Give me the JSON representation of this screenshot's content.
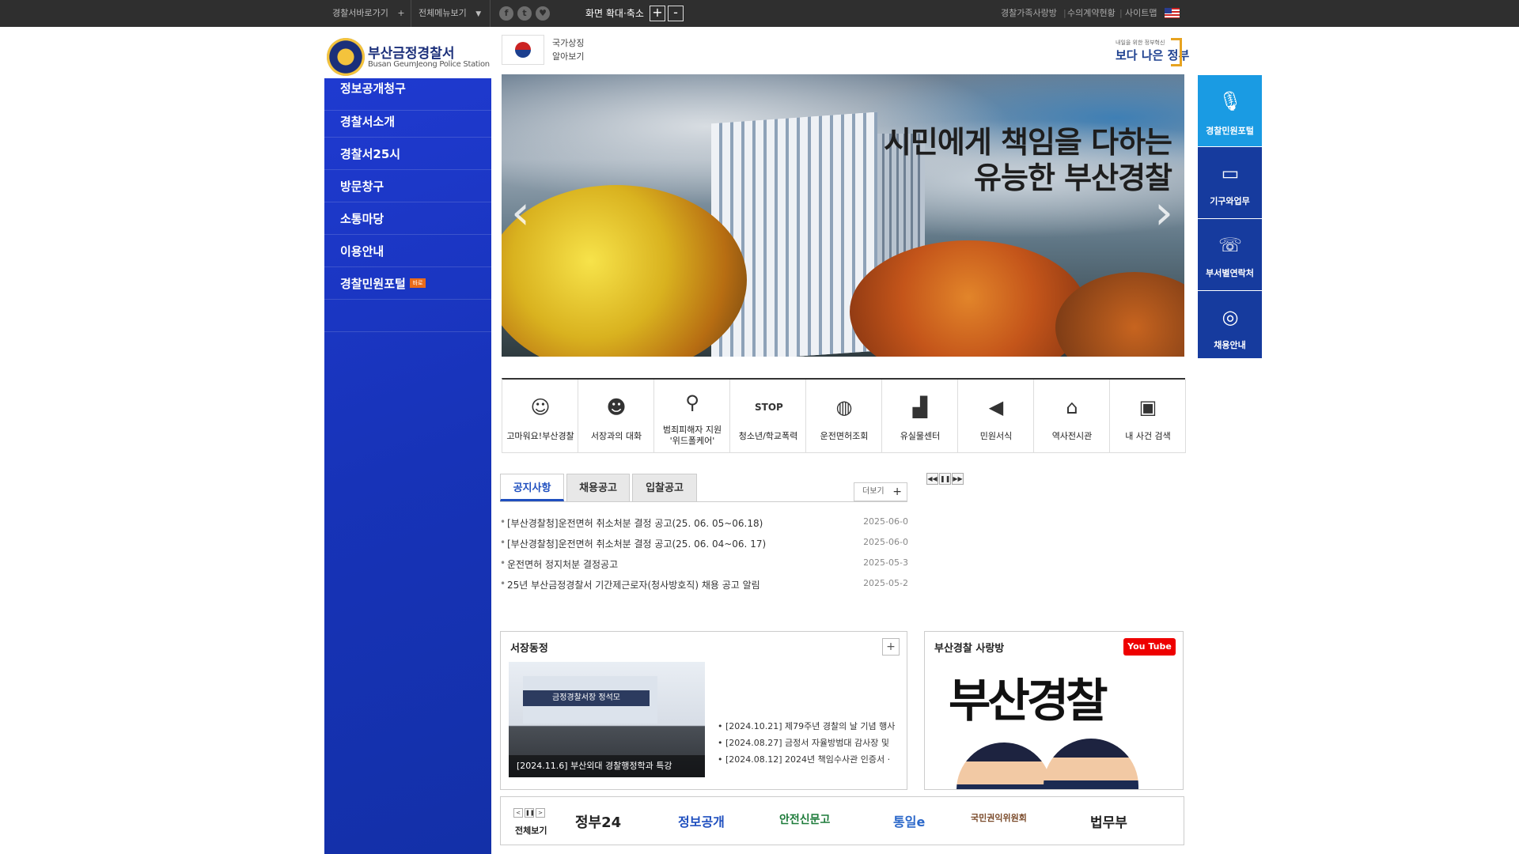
{
  "topbar": {
    "shortcut": "경찰서바로가기",
    "shortcut_glyph": "+",
    "all_menu": "전체메뉴보기",
    "all_menu_glyph": "▼",
    "sns": [
      "f",
      "t",
      "♥"
    ],
    "zoom_label": "화면 확대·축소",
    "zoom_in": "+",
    "zoom_out": "-",
    "links": [
      "경찰가족사랑방",
      "수의계약현황",
      "사이트맵"
    ]
  },
  "header": {
    "logo_ko": "부산금정경찰서",
    "logo_en": "Busan GeumJeong Police Station",
    "national_symbol_line1": "국가상징",
    "national_symbol_line2": "알아보기",
    "gov_small": "내일을 위한 정부혁신",
    "gov_big": "보다 나은 정부"
  },
  "leftnav": {
    "items": [
      "정보공개청구",
      "경찰서소개",
      "경찰서25시",
      "방문창구",
      "소통마당",
      "이용안내",
      "경찰민원포털"
    ],
    "badge": "바로"
  },
  "slider": {
    "line1": "시민에게 책임을 다하는",
    "line2": "유능한 부산경찰",
    "prev": "‹",
    "next": "›"
  },
  "quick": [
    {
      "label": "경찰민원포털",
      "icon": "microphone-icon",
      "glyph": "🎙",
      "color": "#1a9be3"
    },
    {
      "label": "기구와업무",
      "icon": "monitor-icon",
      "glyph": "▭",
      "color": "#163b9e"
    },
    {
      "label": "부서별연락처",
      "icon": "phone-icon",
      "glyph": "☏",
      "color": "#163b9e"
    },
    {
      "label": "채용안내",
      "icon": "lightbulb-icon",
      "glyph": "◎",
      "color": "#163b9e"
    }
  ],
  "services": [
    {
      "label": "고마워요!부산경찰",
      "icon": "police-mascot-icon",
      "glyph": "☺"
    },
    {
      "label": "서장과의 대화",
      "icon": "chat-bubble-icon",
      "glyph": "☻"
    },
    {
      "label": "범죄피해자 지원\n'위드폴케어'",
      "icon": "search-magnifier-icon",
      "glyph": "⚲"
    },
    {
      "label": "청소년/학교폭력",
      "icon": "stop-sign-icon",
      "glyph": "STOP"
    },
    {
      "label": "운전면허조회",
      "icon": "globe-icon",
      "glyph": "◍"
    },
    {
      "label": "유실물센터",
      "icon": "chart-building-icon",
      "glyph": "▟"
    },
    {
      "label": "민원서식",
      "icon": "speaker-icon",
      "glyph": "◀"
    },
    {
      "label": "역사전시관",
      "icon": "house-icon",
      "glyph": "⌂"
    },
    {
      "label": "내 사건 검색",
      "icon": "monitor-cursor-icon",
      "glyph": "▣"
    }
  ],
  "notice": {
    "tabs": [
      "공지사항",
      "채용공고",
      "입찰공고"
    ],
    "more": "더보기",
    "more_glyph": "+",
    "bullet": "•",
    "items": [
      {
        "title": "[부산경찰청]운전면허 취소처분 결정 공고(25. 06. 05~06.18)",
        "date": "2025-06-0"
      },
      {
        "title": "[부산경찰청]운전면허 취소처분 결정 공고(25. 06. 04~06. 17)",
        "date": "2025-06-0"
      },
      {
        "title": "운전면허 정지처분 결정공고",
        "date": "2025-05-3"
      },
      {
        "title": "25년 부산금정경찰서 기간제근로자(청사방호직) 채용 공고 알림",
        "date": "2025-05-2"
      }
    ]
  },
  "popup_controls": [
    "◀◀",
    "❚❚",
    "▶▶"
  ],
  "chief": {
    "title": "서장동정",
    "plus": "+",
    "banner_text": "금정경찰서장 정석모",
    "photo_caption": "[2024.11.6] 부산외대 경찰행정학과 특강",
    "bullet": "•",
    "news": [
      "[2024.10.21] 제79주년 경찰의 날 기념 행사",
      "[2024.08.27] 금정서 자율방범대 감사장 및",
      "[2024.08.12] 2024년 책임수사관 인증서 ·"
    ]
  },
  "youtube": {
    "title": "부산경찰 사랑방",
    "badge": "You Tube",
    "calligraphy": "부산경찰"
  },
  "banner": {
    "controls": [
      "<",
      "❚❚",
      ">"
    ],
    "all": "전체보기",
    "partners": [
      {
        "name": "정부24",
        "color": "#222"
      },
      {
        "name": "정보공개",
        "color": "#1f4fbf"
      },
      {
        "name": "안전신문고",
        "color": "#1d7b3a"
      },
      {
        "name": "통일e",
        "color": "#2a67c9"
      },
      {
        "name": "국민권익위원회",
        "color": "#7a4a2a"
      },
      {
        "name": "법무부",
        "color": "#222"
      }
    ]
  }
}
